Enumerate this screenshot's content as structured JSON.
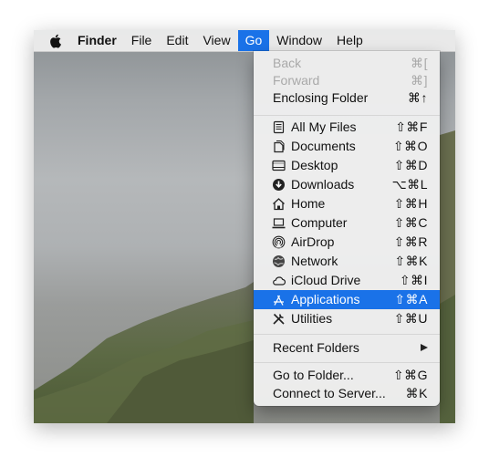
{
  "menubar": {
    "app_name": "Finder",
    "items": [
      "File",
      "Edit",
      "View",
      "Go",
      "Window",
      "Help"
    ],
    "active": "Go"
  },
  "go_menu": {
    "back": {
      "label": "Back",
      "shortcut": "⌘["
    },
    "forward": {
      "label": "Forward",
      "shortcut": "⌘]"
    },
    "enclosing": {
      "label": "Enclosing Folder",
      "shortcut": "⌘↑"
    },
    "places": [
      {
        "label": "All My Files",
        "shortcut": "⇧⌘F",
        "icon": "all-my-files-icon"
      },
      {
        "label": "Documents",
        "shortcut": "⇧⌘O",
        "icon": "documents-icon"
      },
      {
        "label": "Desktop",
        "shortcut": "⇧⌘D",
        "icon": "desktop-icon"
      },
      {
        "label": "Downloads",
        "shortcut": "⌥⌘L",
        "icon": "downloads-icon"
      },
      {
        "label": "Home",
        "shortcut": "⇧⌘H",
        "icon": "home-icon"
      },
      {
        "label": "Computer",
        "shortcut": "⇧⌘C",
        "icon": "computer-icon"
      },
      {
        "label": "AirDrop",
        "shortcut": "⇧⌘R",
        "icon": "airdrop-icon"
      },
      {
        "label": "Network",
        "shortcut": "⇧⌘K",
        "icon": "network-icon"
      },
      {
        "label": "iCloud Drive",
        "shortcut": "⇧⌘I",
        "icon": "icloud-drive-icon"
      },
      {
        "label": "Applications",
        "shortcut": "⇧⌘A",
        "icon": "applications-icon"
      },
      {
        "label": "Utilities",
        "shortcut": "⇧⌘U",
        "icon": "utilities-icon"
      }
    ],
    "selected": "Applications",
    "recent_folders": {
      "label": "Recent Folders"
    },
    "go_to_folder": {
      "label": "Go to Folder...",
      "shortcut": "⇧⌘G"
    },
    "connect_to_server": {
      "label": "Connect to Server...",
      "shortcut": "⌘K"
    }
  },
  "colors": {
    "selection": "#1a72e8",
    "menu_bg": "#eeeeee",
    "disabled_text": "#a9a9a9"
  }
}
